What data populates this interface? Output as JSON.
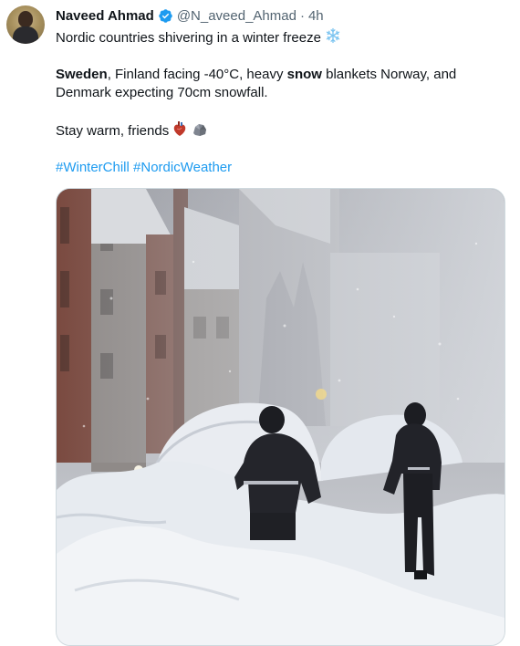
{
  "tweet": {
    "display_name": "Naveed Ahmad",
    "handle": "@N_aveed_Ahmad",
    "separator": "·",
    "time": "4h",
    "text": {
      "line1": "Nordic countries shivering in a winter freeze",
      "p2_bold1": "Sweden",
      "p2_text1": ", Finland facing -40°C, heavy ",
      "p2_bold2": "snow",
      "p2_text2": " blankets Norway, and Denmark expecting 70cm snowfall.",
      "p3": "Stay warm, friends",
      "hashtags": [
        "#WinterChill",
        "#NordicWeather"
      ]
    },
    "icons": {
      "avatar": "avatar",
      "verified": "verified-badge-icon",
      "snowflake": "snowflake-icon",
      "heart": "anatomical-heart-icon",
      "rock": "rock-icon"
    },
    "colors": {
      "text": "#0f1419",
      "muted": "#536471",
      "link": "#1d9bf0",
      "verified": "#1d9bf0"
    }
  }
}
